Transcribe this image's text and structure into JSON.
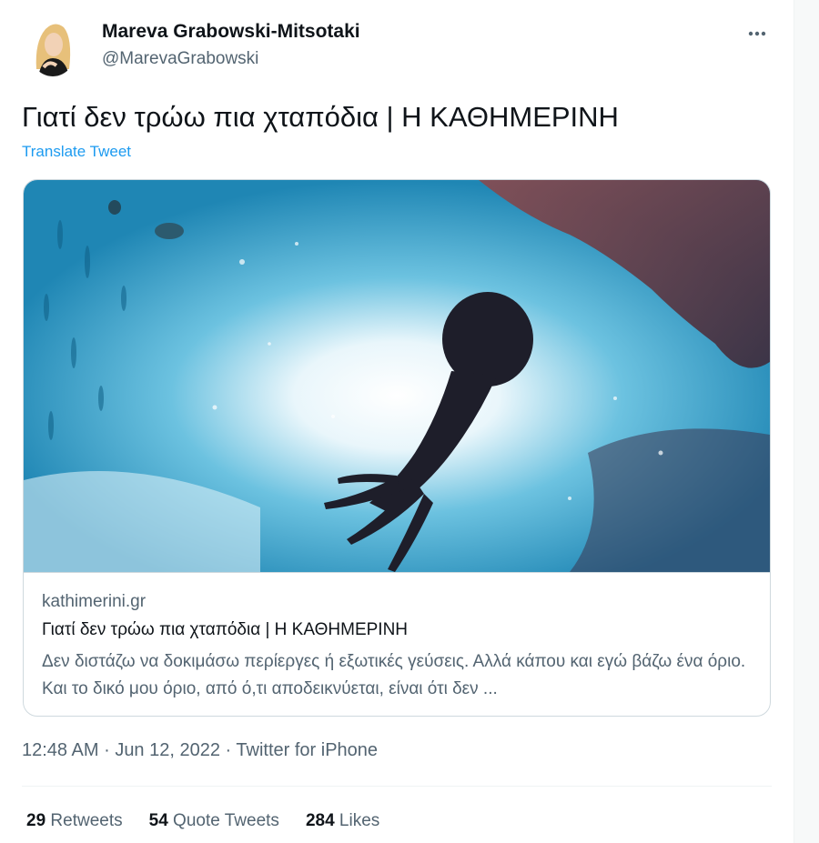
{
  "tweet": {
    "author": {
      "display_name": "Mareva Grabowski-Mitsotaki",
      "handle": "@MarevaGrabowski",
      "avatar_icon": "profile-photo"
    },
    "more_icon": "more-dots-icon",
    "text": "Γιατί δεν τρώω πια χταπόδια | Η ΚΑΘΗΜΕΡΙΝΗ",
    "translate_label": "Translate Tweet",
    "card": {
      "image_alt_icon": "octopus-underwater-photo",
      "domain": "kathimerini.gr",
      "title": "Γιατί δεν τρώω πια χταπόδια | Η ΚΑΘΗΜΕΡΙΝΗ",
      "description": "Δεν διστάζω να δοκιμάσω περίεργες ή εξωτικές γεύσεις. Αλλά κάπου και εγώ βάζω ένα όριο. Και το δικό μου όριο, από ό,τι αποδεικνύεται, είναι ότι δεν ..."
    },
    "meta": {
      "time": "12:48 AM",
      "date": "Jun 12, 2022",
      "separator": "·",
      "source": "Twitter for iPhone"
    },
    "stats": [
      {
        "count": "29",
        "label": "Retweets"
      },
      {
        "count": "54",
        "label": "Quote Tweets"
      },
      {
        "count": "284",
        "label": "Likes"
      }
    ]
  },
  "colors": {
    "link_blue": "#1d9bf0",
    "secondary_text": "#536471",
    "primary_text": "#0f1419",
    "border": "#cfd9de"
  }
}
